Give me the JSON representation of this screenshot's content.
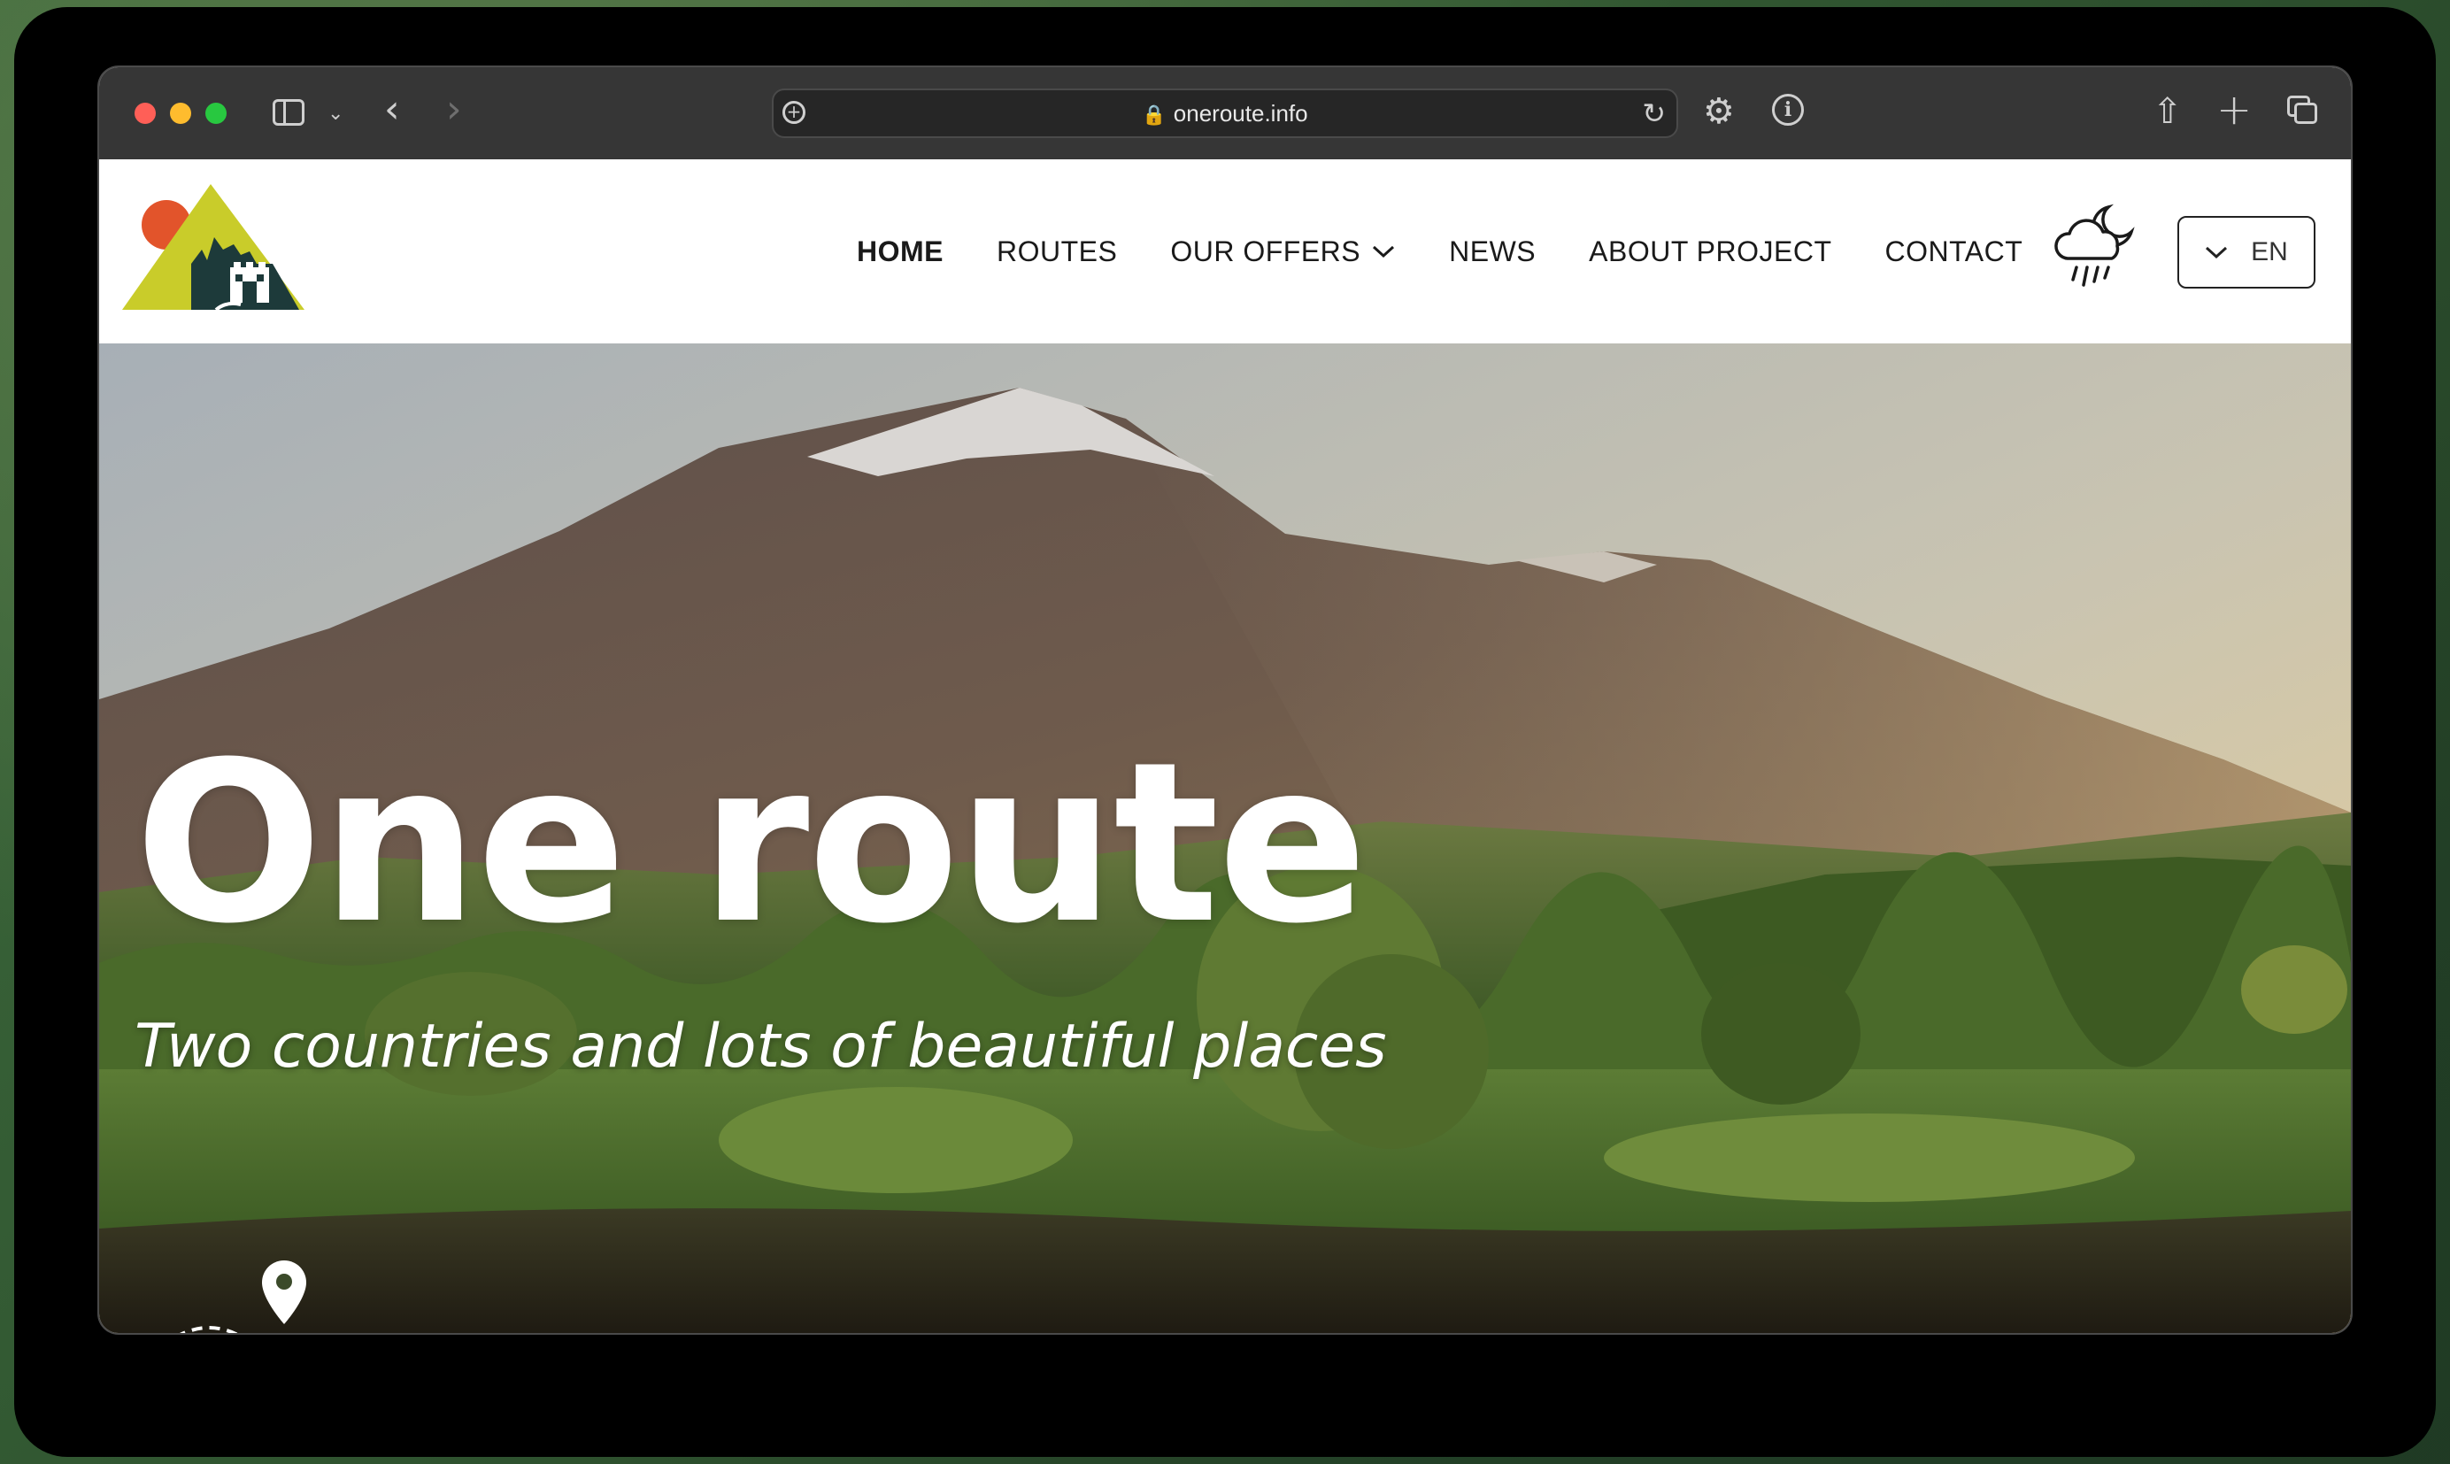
{
  "browser": {
    "url": "oneroute.info",
    "icons": [
      "sidebar-icon",
      "chevron-down-icon",
      "back-arrow-icon",
      "forward-arrow-icon",
      "add-icon",
      "lock-icon",
      "reload-icon",
      "gear-icon",
      "info-icon",
      "share-icon",
      "new-tab-icon",
      "tabs-overview-icon"
    ]
  },
  "header": {
    "nav": [
      {
        "label": "HOME",
        "active": true
      },
      {
        "label": "ROUTES",
        "active": false
      },
      {
        "label": "OUR OFFERS",
        "active": false,
        "has_dropdown": true
      },
      {
        "label": "NEWS",
        "active": false
      },
      {
        "label": "ABOUT PROJECT",
        "active": false
      },
      {
        "label": "CONTACT",
        "active": false
      }
    ],
    "language": "EN",
    "weather_icon": "cloud-moon-rain-icon"
  },
  "hero": {
    "title": "One route",
    "subtitle": "Two countries and lots of beautiful places"
  },
  "colors": {
    "logo_yellow": "#c9cc2a",
    "logo_orange": "#e2542b",
    "logo_dark": "#1d3a3a",
    "titlebar": "#363636"
  }
}
